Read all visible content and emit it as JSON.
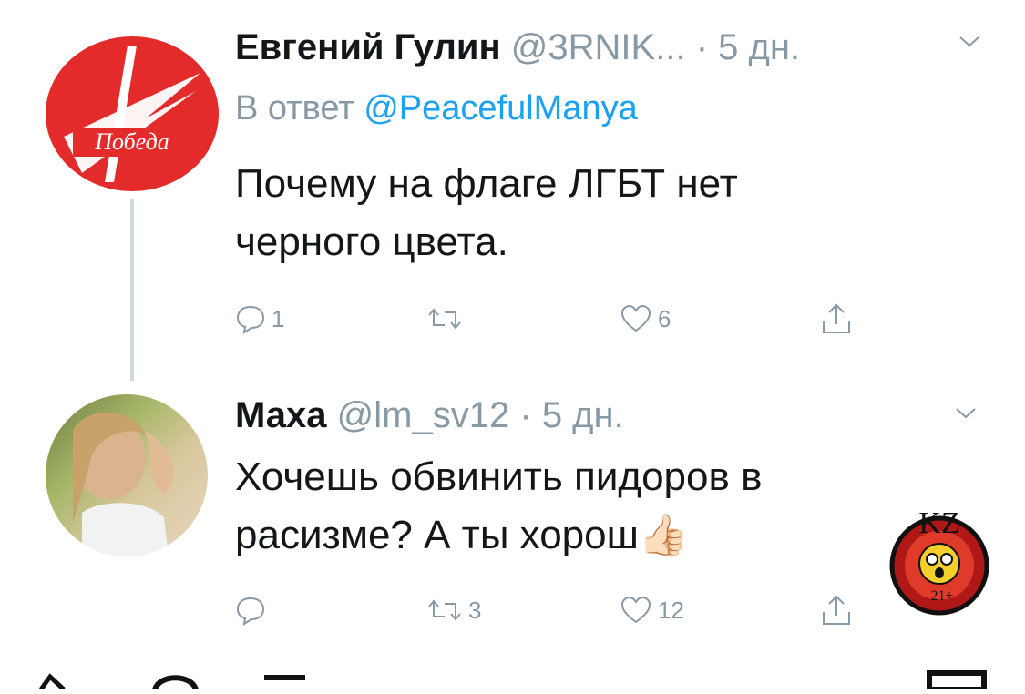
{
  "tweet1": {
    "avatar_logo_text": "Победа",
    "name": "Евгений Гулин",
    "handle": "@3RNIK...",
    "separator": "·",
    "time": "5 дн.",
    "reply_prefix": "В ответ",
    "reply_mention": "@PeacefulManya",
    "text_line1": "Почему на флаге ЛГБТ нет",
    "text_line2": "черного цвета.",
    "reply_count": "1",
    "retweet_count": "",
    "like_count": "6"
  },
  "tweet2": {
    "name": "Маха",
    "handle": "@lm_sv12",
    "separator": "·",
    "time": "5 дн.",
    "text_line1": "Хочешь обвинить пидоров в",
    "text_line2": "расизме? А ты хорош",
    "emoji": "👍🏻",
    "reply_count": "",
    "retweet_count": "3",
    "like_count": "12"
  },
  "watermark": {
    "letters": "KZ",
    "age": "21+"
  },
  "colors": {
    "accent": "#1da1f2",
    "muted": "#8899a6",
    "logo_red": "#e32b2b"
  },
  "icons": [
    "reply-icon",
    "retweet-icon",
    "like-icon",
    "share-icon",
    "chevron-down-icon"
  ]
}
